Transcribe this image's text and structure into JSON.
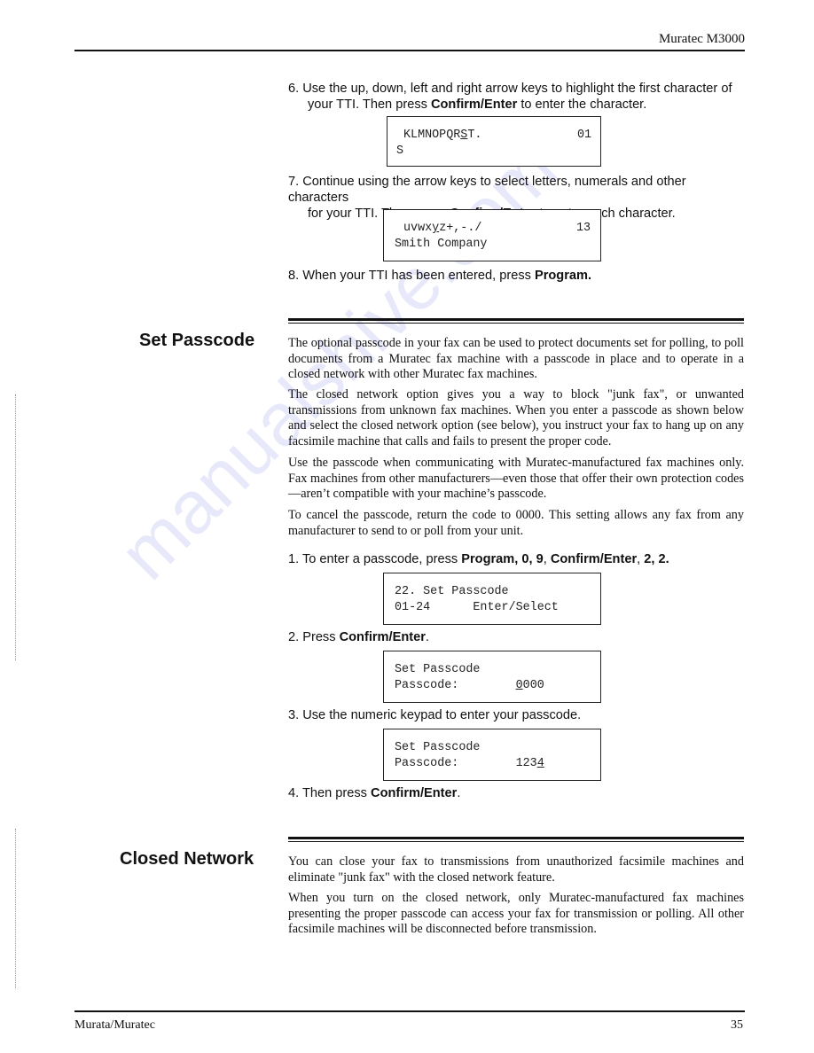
{
  "header": {
    "title": "Muratec M3000"
  },
  "steps_top": [
    {
      "prefix": "6. Use the up, down, left and right arrow keys to highlight the first character of",
      "line2_pre": "your TTI. Then press ",
      "bold": "Confirm/Enter",
      "line2_post": " to enter the character."
    },
    {
      "prefix": "7. Continue using the arrow keys to select letters, numerals and other characters",
      "line2_pre": "for your TTI. Then press ",
      "bold": "Confirm/Enter",
      "line2_post": " to enter each character."
    },
    {
      "pre": "8. When your TTI has been entered, press ",
      "bold": "Program."
    }
  ],
  "lcd_displays": [
    {
      "line1_pre": "KLMNOPQR",
      "line1_cursor": "S",
      "line1_post": "T.",
      "line1_right": "01",
      "line2": "S"
    },
    {
      "line1_pre": "uvwx",
      "line1_cursor": "y",
      "line1_post": "z+,-./",
      "line1_right": "13",
      "line2": "Smith Company"
    },
    {
      "line1": "22. Set Passcode",
      "line2": "01-24      Enter/Select"
    },
    {
      "line1": "Set Passcode",
      "line2_pre": "Passcode:        ",
      "line2_cursor": "0",
      "line2_post": "000"
    },
    {
      "line1": "Set Passcode",
      "line2_pre": "Passcode:        123",
      "line2_cursor": "4",
      "line2_post": ""
    }
  ],
  "set_passcode": {
    "title": "Set Passcode",
    "paragraphs": [
      "The optional passcode in your fax can be used to protect documents set for polling, to poll documents from a Muratec fax machine with a passcode in place and to operate in a closed network with other Muratec fax machines.",
      "The closed network option gives you a way to block \"junk fax\", or unwanted transmissions from unknown fax machines. When you enter a passcode as shown below and select the closed network option (see below), you instruct your fax to hang up on any facsimile machine that calls and fails to present the proper code.",
      "Use the passcode when communicating with Muratec-manufactured fax machines only. Fax machines from other manufacturers—even those that offer their own protection codes—aren’t compatible with your machine’s passcode.",
      "To cancel the passcode, return the code to 0000. This setting allows any fax from any manufacturer to send to or poll from your unit."
    ],
    "steps": [
      {
        "pre": "1. To enter a passcode, press ",
        "bold1": "Program, 0, 9",
        "mid": ", ",
        "bold2": "Confirm/Enter",
        "mid2": ", ",
        "bold3": "2, 2."
      },
      {
        "pre": "2. Press ",
        "bold": "Confirm/Enter",
        "post": "."
      },
      {
        "pre": "3. Use the numeric keypad to enter your passcode.",
        "bold": "",
        "post": ""
      },
      {
        "pre": "4. Then press ",
        "bold": "Confirm/Enter",
        "post": "."
      }
    ]
  },
  "closed_network": {
    "title": "Closed Network",
    "paragraphs": [
      "You can close your fax to transmissions from unauthorized facsimile machines and eliminate \"junk fax\" with the closed network feature.",
      "When you turn on the closed network, only Muratec-manufactured fax machines presenting the proper passcode can access your fax for transmission or polling. All other facsimile machines will be disconnected before transmission."
    ]
  },
  "footer": {
    "left": "Murata/Muratec",
    "page_number": "35"
  },
  "watermark": {
    "text": "manualshive.com",
    "color": "#6e6ee6"
  }
}
